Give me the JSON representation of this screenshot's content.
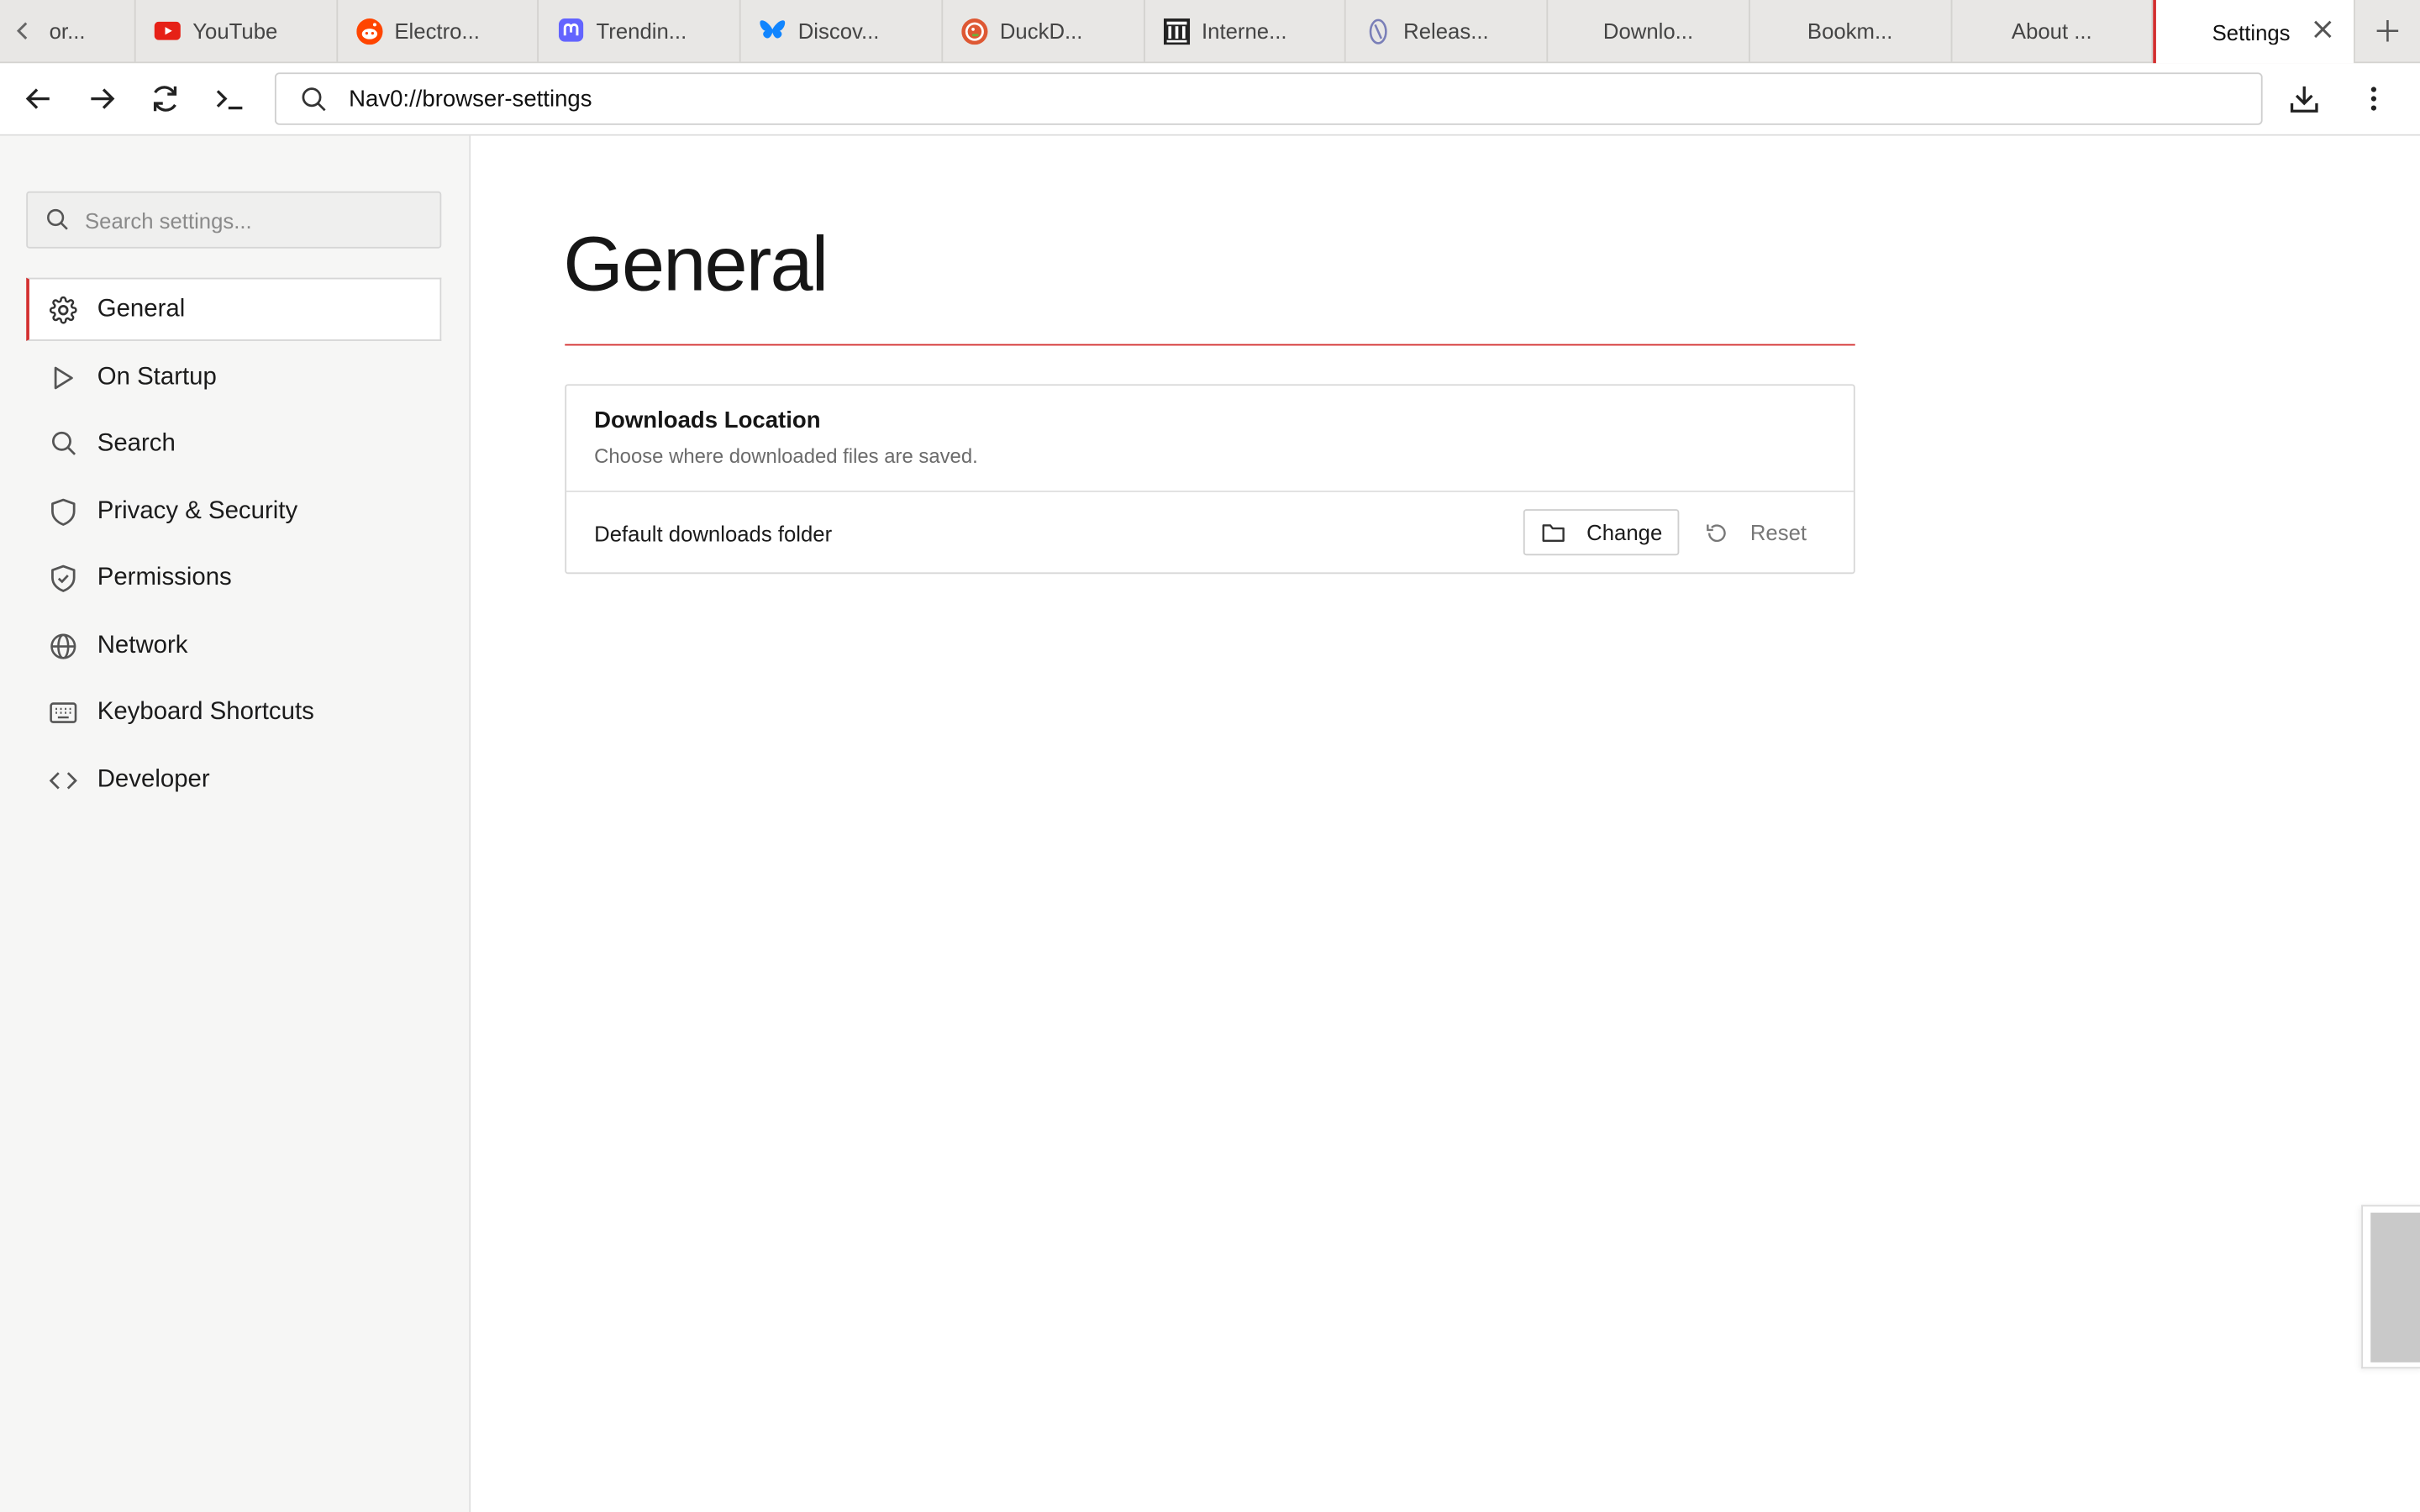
{
  "tabs": [
    {
      "label": "or...",
      "favicon": "page-icon"
    },
    {
      "label": "YouTube",
      "favicon": "youtube-icon",
      "color": "#e62117"
    },
    {
      "label": "Electro...",
      "favicon": "reddit-icon",
      "color": "#ff4500"
    },
    {
      "label": "Trendin...",
      "favicon": "mastodon-icon",
      "color": "#6364ff"
    },
    {
      "label": "Discov...",
      "favicon": "bluesky-icon",
      "color": "#1185fe"
    },
    {
      "label": "DuckD...",
      "favicon": "duckduckgo-icon",
      "color": "#de5833"
    },
    {
      "label": "Interne...",
      "favicon": "internet-archive-icon",
      "color": "#222222"
    },
    {
      "label": "Releas...",
      "favicon": "release-icon",
      "color": "#7a7fb8"
    },
    {
      "label": "Downlo..."
    },
    {
      "label": "Bookm..."
    },
    {
      "label": "About ..."
    }
  ],
  "active_tab": {
    "label": "Settings",
    "accent": "#d32f2f"
  },
  "toolbar": {
    "url": "Nav0://browser-settings"
  },
  "sidebar": {
    "search_placeholder": "Search settings...",
    "items": [
      {
        "label": "General",
        "icon": "gear-icon",
        "active": true
      },
      {
        "label": "On Startup",
        "icon": "play-icon"
      },
      {
        "label": "Search",
        "icon": "search-icon"
      },
      {
        "label": "Privacy & Security",
        "icon": "shield-icon"
      },
      {
        "label": "Permissions",
        "icon": "shield-check-icon"
      },
      {
        "label": "Network",
        "icon": "globe-icon"
      },
      {
        "label": "Keyboard Shortcuts",
        "icon": "keyboard-icon"
      },
      {
        "label": "Developer",
        "icon": "code-icon"
      }
    ]
  },
  "main": {
    "title": "General",
    "card": {
      "title": "Downloads Location",
      "subtitle": "Choose where downloaded files are saved.",
      "row_label": "Default downloads folder",
      "change_label": "Change",
      "reset_label": "Reset"
    }
  }
}
